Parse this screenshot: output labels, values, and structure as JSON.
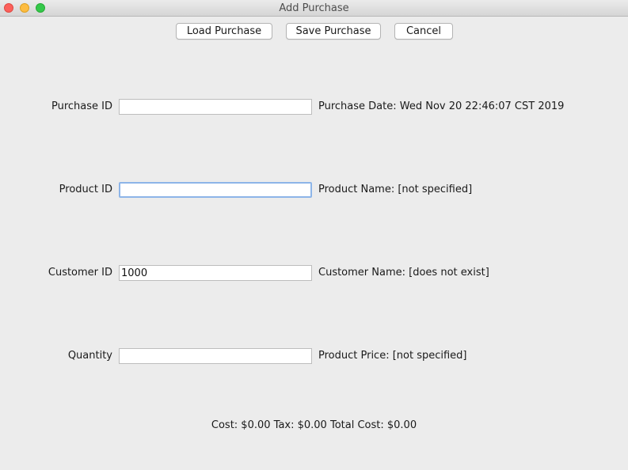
{
  "window": {
    "title": "Add Purchase"
  },
  "toolbar": {
    "load_label": "Load Purchase",
    "save_label": "Save Purchase",
    "cancel_label": "Cancel"
  },
  "form": {
    "purchase_id": {
      "label": "Purchase ID",
      "value": "",
      "info": "Purchase Date: Wed Nov 20 22:46:07 CST 2019"
    },
    "product_id": {
      "label": "Product ID",
      "value": "",
      "info": "Product Name: [not specified]"
    },
    "customer_id": {
      "label": "Customer ID",
      "value": "1000",
      "info": "Customer Name: [does not exist]"
    },
    "quantity": {
      "label": "Quantity",
      "value": "",
      "info": "Product Price: [not specified]"
    }
  },
  "totals": {
    "text": "Cost: $0.00 Tax: $0.00 Total Cost: $0.00"
  },
  "colors": {
    "window_bg": "#ececec",
    "focus_ring": "#8db5e8",
    "close": "#fc605b",
    "minimize": "#fdbc40",
    "zoom": "#34c84a"
  },
  "icons": [
    "close-window-icon",
    "minimize-window-icon",
    "zoom-window-icon"
  ]
}
